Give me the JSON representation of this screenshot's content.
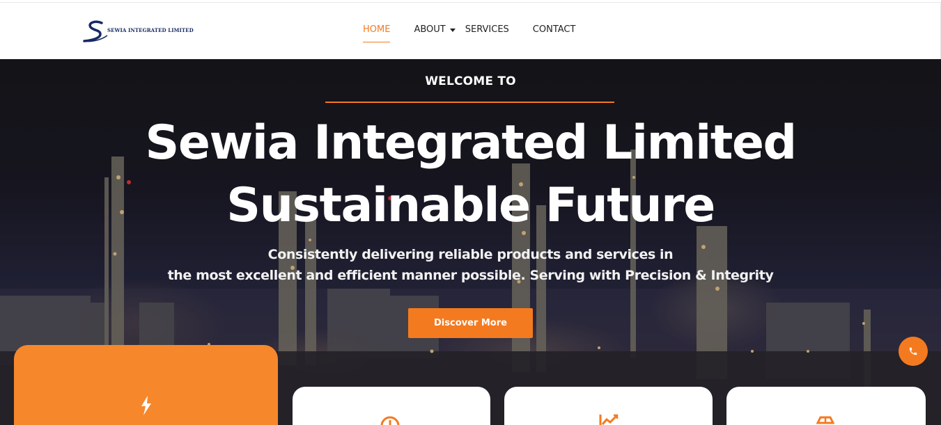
{
  "brand": {
    "logo_text": "SEWIA INTEGRATED LIMITED",
    "accent_color": "#f47a20",
    "navy_color": "#142a63"
  },
  "nav": {
    "items": [
      {
        "label": "HOME",
        "active": true
      },
      {
        "label": "ABOUT",
        "has_dropdown": true
      },
      {
        "label": "SERVICES"
      },
      {
        "label": "CONTACT"
      }
    ]
  },
  "hero": {
    "welcome": "WELCOME TO",
    "title_line1": "Sewia Integrated Limited",
    "title_line2": "Sustainable Future",
    "subtitle_line1": "Consistently delivering reliable products and services in",
    "subtitle_line2": "the most excellent and efficient manner possible. Serving with Precision & Integrity",
    "cta_label": "Discover More",
    "background": "industrial refinery at night"
  },
  "floating": {
    "phone_icon": "phone-icon"
  },
  "feature_cards": [
    {
      "style": "orange",
      "icon": "lightning-icon"
    },
    {
      "style": "white",
      "icon": "gauge-icon"
    },
    {
      "style": "white",
      "icon": "trend-chart-icon"
    },
    {
      "style": "white",
      "icon": "store-icon"
    }
  ]
}
